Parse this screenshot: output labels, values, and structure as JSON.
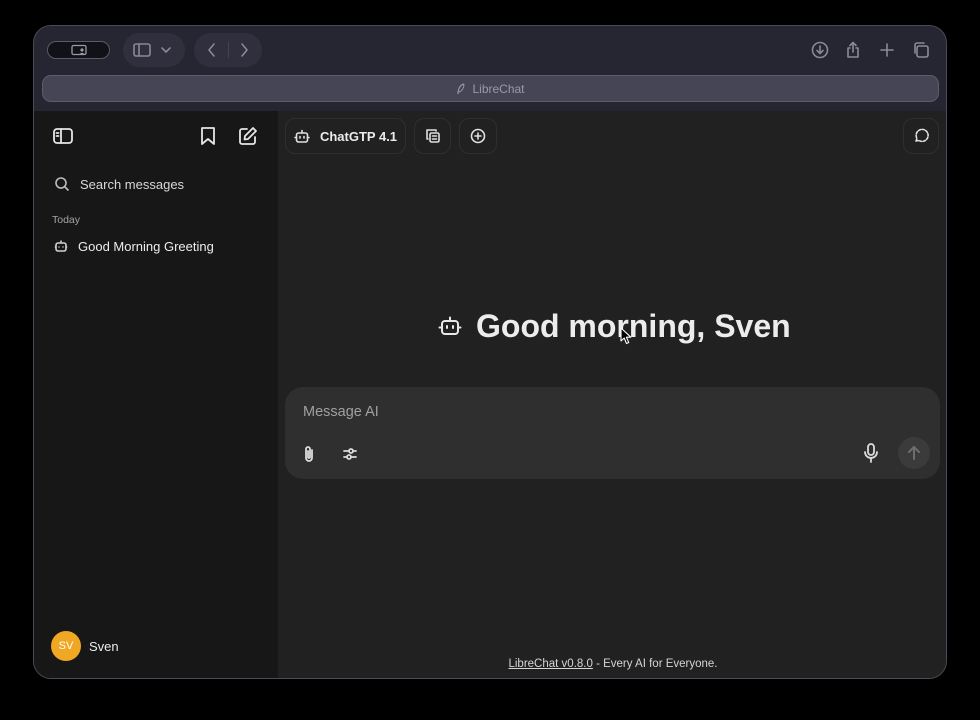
{
  "browser": {
    "url_text": "LibreChat",
    "icons": [
      "profile-icon",
      "sidebar-icon",
      "chevron-down-icon",
      "back-icon",
      "forward-icon",
      "download-icon",
      "share-icon",
      "new-tab-icon",
      "tabs-overview-icon",
      "feather-icon"
    ]
  },
  "sidebar": {
    "search_placeholder": "Search messages",
    "section_label": "Today",
    "conversations": [
      {
        "title": "Good Morning Greeting"
      }
    ],
    "user": {
      "initials": "SV",
      "name": "Sven"
    }
  },
  "header": {
    "model_label": "ChatGTP 4.1"
  },
  "main": {
    "greeting": "Good morning, Sven",
    "composer": {
      "placeholder": "Message AI"
    }
  },
  "footer": {
    "link_text": "LibreChat v0.8.0",
    "tagline": " - Every AI for Everyone."
  },
  "colors": {
    "avatar": "#f0a824",
    "sidebar_bg": "#171717",
    "main_bg": "#212121",
    "composer_bg": "#2f2f2f"
  }
}
